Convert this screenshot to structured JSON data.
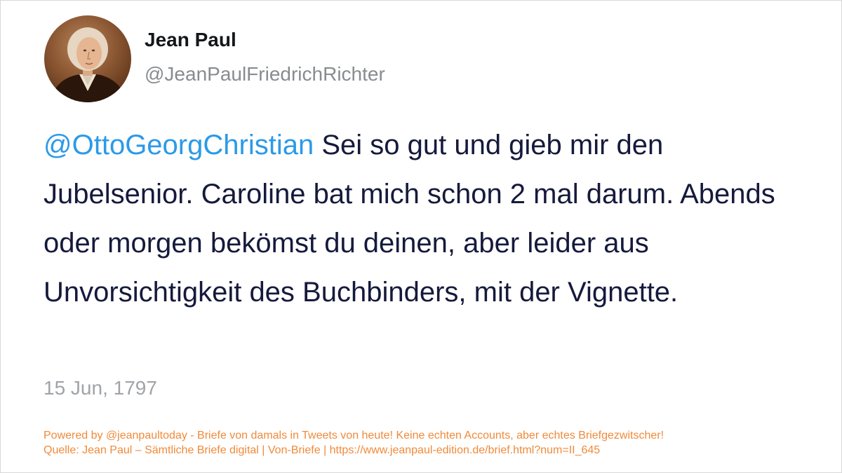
{
  "tweet": {
    "avatar_icon": "portrait-avatar",
    "display_name": "Jean Paul",
    "handle": "@JeanPaulFriedrichRichter",
    "mention": "@OttoGeorgChristian",
    "text": " Sei so gut und gieb mir den Jubelsenior. Caroline bat mich schon 2 mal darum. Abends oder morgen bekömst du deinen, aber leider aus Unvorsichtigkeit des Buchbinders, mit der Vignette.",
    "date": "15 Jun, 1797"
  },
  "footer": {
    "line1": "Powered by @jeanpaultoday - Briefe von damals in Tweets von heute! Keine echten Accounts, aber echtes Briefgezwitscher!",
    "line2": "Quelle: Jean Paul – Sämtliche Briefe digital | Von-Briefe | https://www.jeanpaul-edition.de/brief.html?num=II_645"
  },
  "colors": {
    "mention": "#2b9ae8",
    "text": "#151a3c",
    "footer": "#f08a3a",
    "handle": "#888c90"
  }
}
